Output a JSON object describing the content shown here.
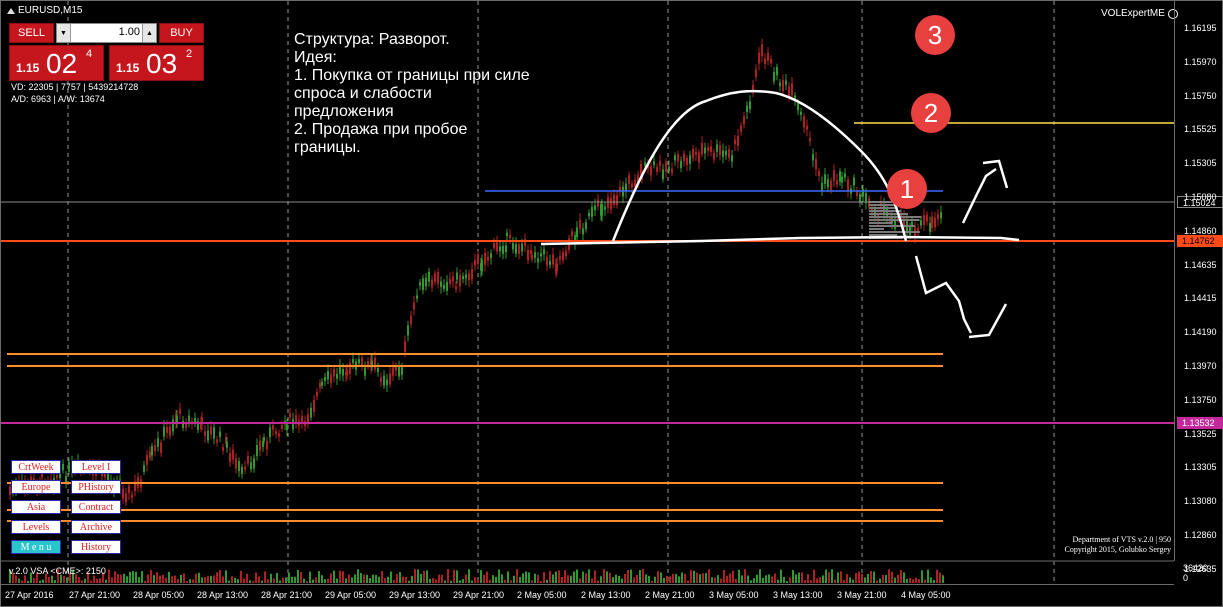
{
  "window": {
    "symbol": "EURUSD,M15"
  },
  "trade_panel": {
    "sell_label": "SELL",
    "buy_label": "BUY",
    "lot": "1.00",
    "sell_price_prefix": "1.15",
    "sell_price_big": "02",
    "sell_price_sup": "4",
    "buy_price_prefix": "1.15",
    "buy_price_big": "03",
    "buy_price_sup": "2"
  },
  "stats": {
    "line1": "VD: 22305 | 7757 | 5439214728",
    "line2": "A/D: 6963 | A/W: 13674"
  },
  "idea": {
    "text": "Структура: Разворот.\nИдея:\n1. Покупка от границы при силе спроса и слабости предложения\n2. Продажа при пробое границы."
  },
  "expert": {
    "name": "VOLExpertME"
  },
  "markers": [
    "1",
    "2",
    "3"
  ],
  "price_axis": {
    "ticks": [
      "1.16195",
      "1.15970",
      "1.15750",
      "1.15525",
      "1.15305",
      "1.15080",
      "1.14860",
      "1.14635",
      "1.14415",
      "1.14190",
      "1.13970",
      "1.13750",
      "1.13525",
      "1.13305",
      "1.13080",
      "1.12860",
      "1.12635"
    ],
    "current_tag": "1.15024",
    "level_tag": "1.14762",
    "magenta_tag": "1.13532"
  },
  "time_axis": {
    "ticks": [
      "27 Apr 2016",
      "27 Apr 21:00",
      "28 Apr 05:00",
      "28 Apr 13:00",
      "28 Apr 21:00",
      "29 Apr 05:00",
      "29 Apr 13:00",
      "29 Apr 21:00",
      "2 May 05:00",
      "2 May 13:00",
      "2 May 21:00",
      "3 May 05:00",
      "3 May 13:00",
      "3 May 21:00",
      "4 May 05:00"
    ]
  },
  "volume_panel": {
    "label": "v.2.0 VSA <CME>: 2150",
    "axis_top": "36420",
    "axis_bottom": "0"
  },
  "menu": {
    "crtweek": "CrtWeek",
    "level1": "Level I",
    "europe": "Europe",
    "phistory": "PHistory",
    "asia": "Asia",
    "contract": "Contract",
    "levels": "Levels",
    "archive": "Archive",
    "menu": "M e n u",
    "history": "History"
  },
  "copyright": {
    "line1": "Department of VTS  v.2.0 | 950",
    "line2": "Copyright 2015, Golubko Sergey"
  },
  "colors": {
    "orange_line": "#ff8c2a",
    "red_line": "#ff4a1a",
    "blue_line": "#3a6bff",
    "yellow_line": "#ffe04a",
    "magenta_line": "#c22a9c",
    "candle_up": "#2f9a2f",
    "candle_down": "#b02020",
    "marker": "#e7403f"
  }
}
